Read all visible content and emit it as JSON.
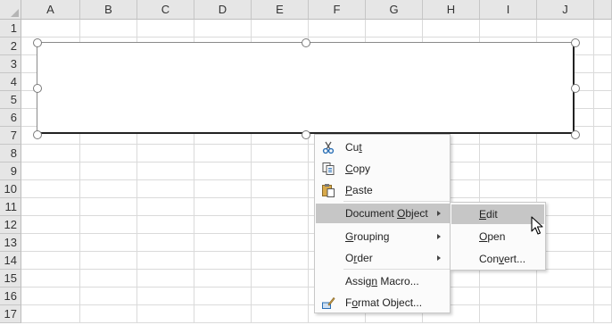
{
  "columns": [
    "A",
    "B",
    "C",
    "D",
    "E",
    "F",
    "G",
    "H",
    "I",
    "J"
  ],
  "rows": [
    "1",
    "2",
    "3",
    "4",
    "5",
    "6",
    "7",
    "8",
    "9",
    "10",
    "11",
    "12",
    "13",
    "14",
    "15",
    "16",
    "17"
  ],
  "context_menu": {
    "items": [
      {
        "label": "Cut",
        "mnemonic_index": 2,
        "icon": "scissors-icon",
        "submenu": false,
        "highlighted": false
      },
      {
        "label": "Copy",
        "mnemonic_index": 0,
        "icon": "copy-icon",
        "submenu": false,
        "highlighted": false
      },
      {
        "label": "Paste",
        "mnemonic_index": 0,
        "icon": "clipboard-paste-icon",
        "submenu": false,
        "highlighted": false
      },
      {
        "label": "Document Object",
        "mnemonic_index": 9,
        "icon": "",
        "submenu": true,
        "highlighted": true
      },
      {
        "label": "Grouping",
        "mnemonic_index": 0,
        "icon": "",
        "submenu": true,
        "highlighted": false
      },
      {
        "label": "Order",
        "mnemonic_index": 1,
        "icon": "",
        "submenu": true,
        "highlighted": false
      },
      {
        "label": "Assign Macro...",
        "mnemonic_index": 5,
        "icon": "",
        "submenu": false,
        "highlighted": false
      },
      {
        "label": "Format Object...",
        "mnemonic_index": 1,
        "icon": "format-object-icon",
        "submenu": false,
        "highlighted": false
      }
    ]
  },
  "submenu": {
    "items": [
      {
        "label": "Edit",
        "mnemonic_index": 0,
        "highlighted": true
      },
      {
        "label": "Open",
        "mnemonic_index": 0,
        "highlighted": false
      },
      {
        "label": "Convert...",
        "mnemonic_index": 3,
        "highlighted": false
      }
    ]
  },
  "colors": {
    "header_bg": "#e6e6e6",
    "gridline": "#dadada",
    "menu_bg": "#fbfbfb",
    "menu_highlight": "#c6c6c6"
  }
}
